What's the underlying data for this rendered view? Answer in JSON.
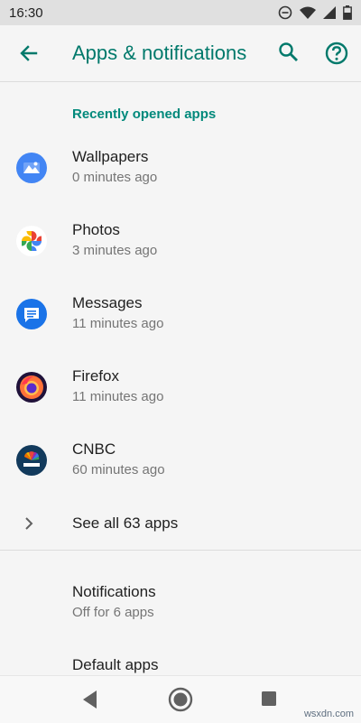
{
  "status_bar": {
    "time": "16:30"
  },
  "header": {
    "title": "Apps & notifications"
  },
  "recent": {
    "section_title": "Recently opened apps",
    "apps": [
      {
        "name": "Wallpapers",
        "time": "0 minutes ago",
        "icon": "wallpapers-icon"
      },
      {
        "name": "Photos",
        "time": "3 minutes ago",
        "icon": "photos-icon"
      },
      {
        "name": "Messages",
        "time": "11 minutes ago",
        "icon": "messages-icon"
      },
      {
        "name": "Firefox",
        "time": "11 minutes ago",
        "icon": "firefox-icon"
      },
      {
        "name": "CNBC",
        "time": "60 minutes ago",
        "icon": "cnbc-icon"
      }
    ],
    "see_all": "See all 63 apps"
  },
  "settings": [
    {
      "name": "Notifications",
      "sub": "Off for 6 apps"
    },
    {
      "name": "Default apps",
      "sub": ""
    }
  ],
  "watermark": "wsxdn.com",
  "colors": {
    "accent": "#00796b",
    "section": "#00897b",
    "background": "#f5f5f5",
    "status_bar": "#e0e0e0"
  }
}
